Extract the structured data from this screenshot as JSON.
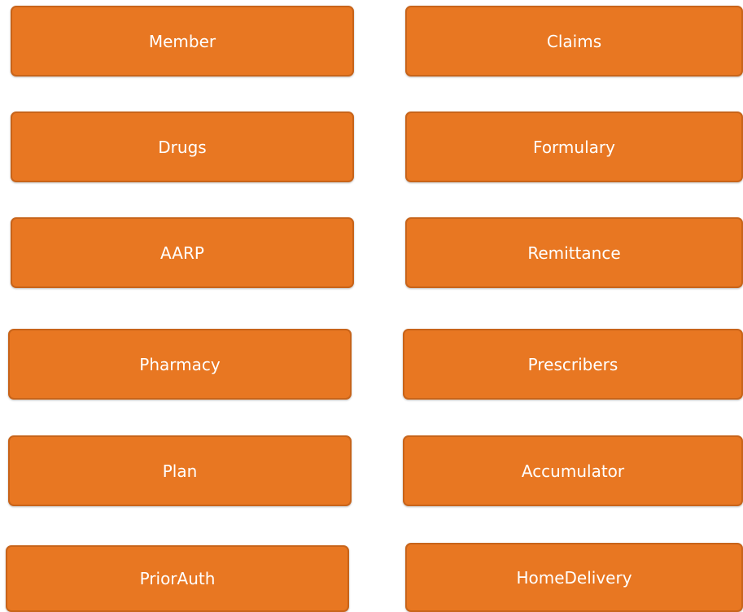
{
  "menu": {
    "member": "Member",
    "claims": "Claims",
    "drugs": "Drugs",
    "formulary": "Formulary",
    "aarp": "AARP",
    "remittance": "Remittance",
    "pharmacy": "Pharmacy",
    "prescribers": "Prescribers",
    "plan": "Plan",
    "accumulator": "Accumulator",
    "priorauth": "PriorAuth",
    "homedelivery": "HomeDelivery"
  },
  "colors": {
    "tile_fill": "#e87722",
    "tile_border": "#c8641a",
    "tile_text": "#ffffff",
    "background": "#ffffff"
  }
}
